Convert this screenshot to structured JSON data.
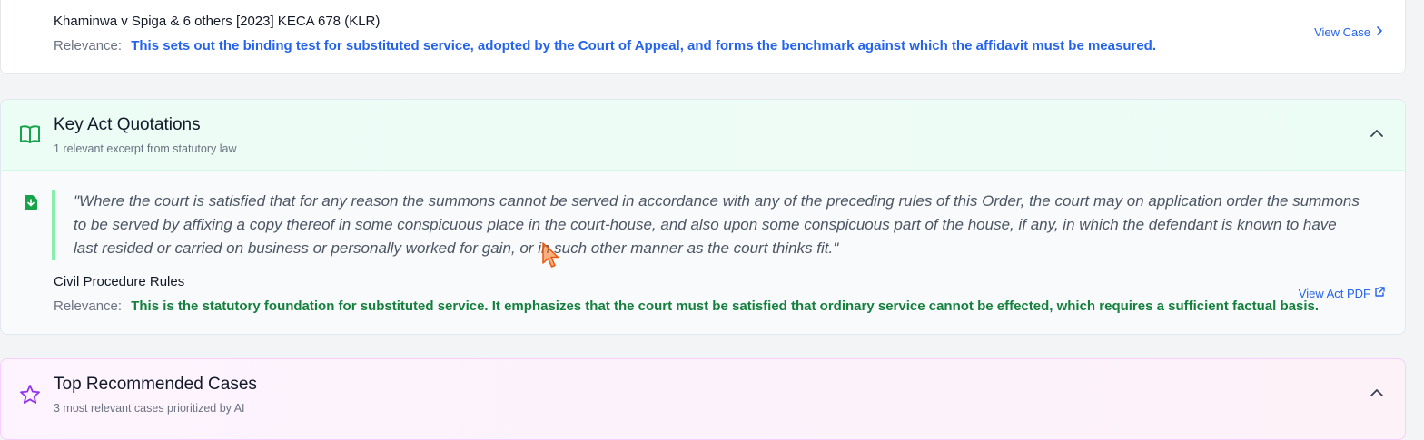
{
  "case_card": {
    "title": "Khaminwa v Spiga & 6 others [2023] KECA 678 (KLR)",
    "relevance_label": "Relevance:",
    "relevance_text": "This sets out the binding test for substituted service, adopted by the Court of Appeal, and forms the benchmark against which the affidavit must be measured.",
    "view_label": "View Case",
    "accent_color": "#2563eb"
  },
  "acts_section": {
    "title": "Key Act Quotations",
    "subtitle": "1 relevant excerpt from statutory law",
    "icon": "book-open-icon",
    "accent_color": "#16a34a",
    "quote": "\"Where the court is satisfied that for any reason the summons cannot be served in accordance with any of the preceding rules of this Order, the court may on application order the summons to be served by affixing a copy thereof in some conspicuous place in the court-house, and also upon some conspicuous part of the house, if any, in which the defendant is known to have last resided or carried on business or personally worked for gain, or in such other manner as the court thinks fit.\"",
    "act_name": "Civil Procedure Rules",
    "relevance_label": "Relevance:",
    "relevance_text": "This is the statutory foundation for substituted service. It emphasizes that the court must be satisfied that ordinary service cannot be effected, which requires a sufficient factual basis.",
    "view_label": "View Act PDF"
  },
  "recs_section": {
    "title": "Top Recommended Cases",
    "subtitle": "3 most relevant cases prioritized by AI",
    "icon": "star-icon",
    "accent_color": "#9333ea"
  }
}
